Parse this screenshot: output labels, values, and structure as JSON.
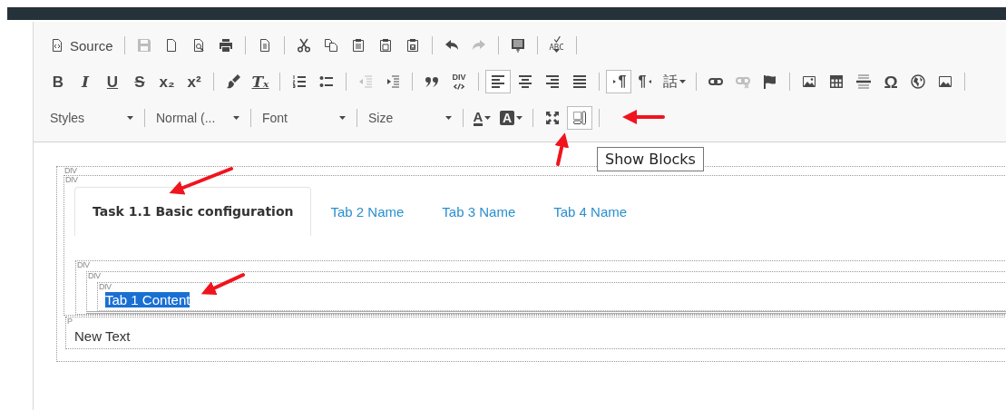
{
  "toolbar": {
    "rows": [
      [
        [
          {
            "kind": "source",
            "label": "Source",
            "disabled": false,
            "on": false
          }
        ],
        [
          {
            "kind": "save",
            "disabled": true,
            "on": false
          },
          {
            "kind": "new-page",
            "disabled": false,
            "on": false
          },
          {
            "kind": "preview",
            "disabled": false,
            "on": false
          },
          {
            "kind": "print",
            "disabled": false,
            "on": false
          }
        ],
        [
          {
            "kind": "templates",
            "disabled": false,
            "on": false
          }
        ],
        [
          {
            "kind": "cut",
            "disabled": false,
            "on": false
          },
          {
            "kind": "copy",
            "disabled": false,
            "on": false
          },
          {
            "kind": "paste",
            "disabled": false,
            "on": false
          },
          {
            "kind": "paste-text",
            "disabled": false,
            "on": false
          },
          {
            "kind": "paste-word",
            "disabled": false,
            "on": false
          }
        ],
        [
          {
            "kind": "undo",
            "disabled": false,
            "on": false
          },
          {
            "kind": "redo",
            "disabled": true,
            "on": false
          }
        ],
        [
          {
            "kind": "select-all",
            "disabled": false,
            "on": false
          }
        ],
        [
          {
            "kind": "spellcheck",
            "glyph": "ABC",
            "disabled": false,
            "on": false
          }
        ]
      ],
      [
        [
          {
            "kind": "bold",
            "glyph": "B",
            "disabled": false,
            "on": false
          },
          {
            "kind": "italic",
            "glyph": "I",
            "disabled": false,
            "on": false
          },
          {
            "kind": "underline",
            "glyph": "U",
            "disabled": false,
            "on": false
          },
          {
            "kind": "strike",
            "glyph": "S",
            "disabled": false,
            "on": false
          },
          {
            "kind": "subscript",
            "glyph": "x₂",
            "disabled": false,
            "on": false
          },
          {
            "kind": "superscript",
            "glyph": "x²",
            "disabled": false,
            "on": false
          }
        ],
        [
          {
            "kind": "copy-format",
            "disabled": false,
            "on": false
          },
          {
            "kind": "remove-format",
            "glyph": "Tₓ",
            "disabled": false,
            "on": false
          }
        ],
        [
          {
            "kind": "numbered-list",
            "disabled": false,
            "on": false
          },
          {
            "kind": "bulleted-list",
            "disabled": false,
            "on": false
          }
        ],
        [
          {
            "kind": "outdent",
            "disabled": true,
            "on": false
          },
          {
            "kind": "indent",
            "disabled": false,
            "on": false
          }
        ],
        [
          {
            "kind": "blockquote",
            "disabled": false,
            "on": false
          },
          {
            "kind": "div",
            "glyph": "DIV",
            "disabled": false,
            "on": false
          }
        ],
        [
          {
            "kind": "align-left",
            "disabled": false,
            "on": true
          },
          {
            "kind": "align-center",
            "disabled": false,
            "on": false
          },
          {
            "kind": "align-right",
            "disabled": false,
            "on": false
          },
          {
            "kind": "justify",
            "disabled": false,
            "on": false
          }
        ],
        [
          {
            "kind": "ltr",
            "glyph": "¶",
            "disabled": false,
            "on": true
          },
          {
            "kind": "rtl",
            "glyph": "¶",
            "disabled": false,
            "on": false
          },
          {
            "kind": "language",
            "glyph": "話",
            "disabled": false,
            "on": false
          }
        ],
        [
          {
            "kind": "link",
            "disabled": false,
            "on": false
          },
          {
            "kind": "unlink",
            "disabled": true,
            "on": false
          },
          {
            "kind": "anchor",
            "disabled": false,
            "on": false
          }
        ],
        [
          {
            "kind": "image",
            "disabled": false,
            "on": false
          },
          {
            "kind": "table",
            "disabled": false,
            "on": false
          },
          {
            "kind": "horizontal-rule",
            "disabled": false,
            "on": false
          },
          {
            "kind": "special-char",
            "glyph": "Ω",
            "disabled": false,
            "on": false
          },
          {
            "kind": "iframe",
            "disabled": false,
            "on": false
          },
          {
            "kind": "media",
            "disabled": false,
            "on": false
          }
        ]
      ],
      [
        [
          {
            "kind": "combo",
            "label": "Styles"
          }
        ],
        [
          {
            "kind": "combo",
            "label": "Normal (..."
          }
        ],
        [
          {
            "kind": "combo",
            "label": "Font"
          }
        ],
        [
          {
            "kind": "combo",
            "label": "Size"
          }
        ],
        [
          {
            "kind": "text-color",
            "glyph": "A",
            "disabled": false,
            "on": false
          },
          {
            "kind": "bg-color",
            "glyph": "A",
            "disabled": false,
            "on": false
          }
        ],
        [
          {
            "kind": "maximize",
            "disabled": false,
            "on": false
          },
          {
            "kind": "show-blocks",
            "disabled": false,
            "on": true
          }
        ]
      ]
    ]
  },
  "tooltip": {
    "text": "Show Blocks"
  },
  "content": [
    {
      "kind": "block",
      "tag": "DIV",
      "children": [
        {
          "kind": "block",
          "tag": "DIV",
          "children": [
            {
              "kind": "tabs",
              "tabs": [
                {
                  "label": "Task 1.1 Basic configuration",
                  "selected": true
                },
                {
                  "label": "Tab 2 Name",
                  "selected": false
                },
                {
                  "label": "Tab 3 Name",
                  "selected": false
                },
                {
                  "label": "Tab 4 Name",
                  "selected": false
                }
              ]
            },
            {
              "kind": "block",
              "tag": "DIV",
              "children": [
                {
                  "kind": "block",
                  "tag": "DIV",
                  "children": [
                    {
                      "kind": "block",
                      "tag": "DIV",
                      "children": [
                        {
                          "kind": "text",
                          "text": "Tab 1 Content",
                          "selected": true
                        }
                      ]
                    }
                  ]
                }
              ]
            }
          ]
        },
        {
          "kind": "block",
          "tag": "P",
          "children": [
            {
              "kind": "text",
              "text": "New Text",
              "selected": false
            }
          ]
        }
      ]
    }
  ]
}
